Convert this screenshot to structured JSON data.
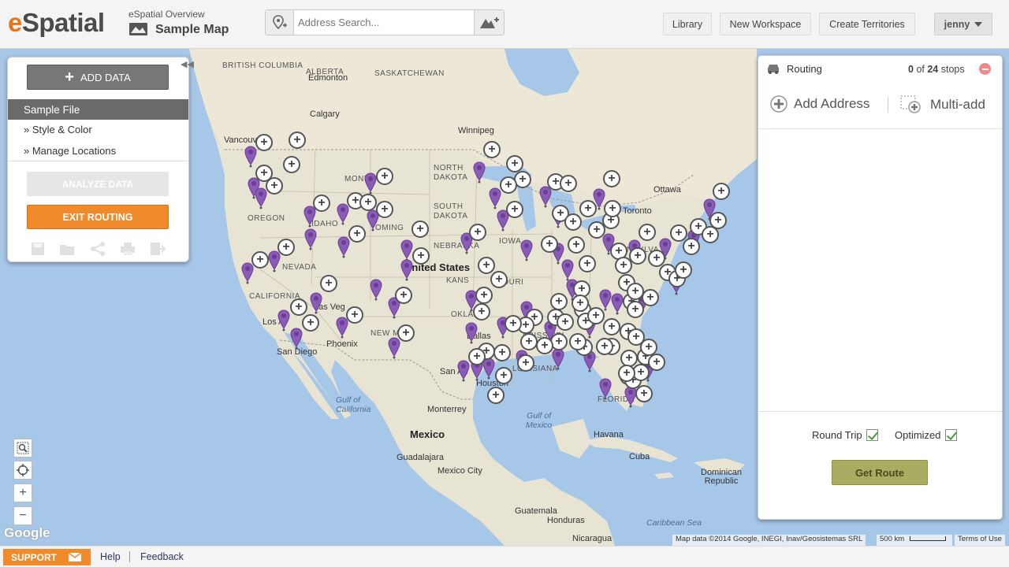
{
  "header": {
    "logo_e": "e",
    "logo_rest": "Spatial",
    "workspace_sub": "eSpatial Overview",
    "workspace_title": "Sample Map",
    "search_placeholder": "Address Search...",
    "buttons": {
      "library": "Library",
      "new_workspace": "New Workspace",
      "create_territories": "Create Territories"
    },
    "user": "jenny"
  },
  "left_panel": {
    "add_data": "ADD DATA",
    "sample_file": "Sample File",
    "style_color": "» Style & Color",
    "manage_locations": "» Manage Locations",
    "analyze": "ANALYZE DATA",
    "exit_routing": "EXIT ROUTING"
  },
  "routing_panel": {
    "title": "Routing",
    "stops_selected": "0",
    "stops_of": "of",
    "stops_total": "24",
    "stops_label": "stops",
    "add_address": "Add Address",
    "multi_add": "Multi-add",
    "round_trip": "Round Trip",
    "optimized": "Optimized",
    "get_route": "Get Route"
  },
  "map": {
    "labels": {
      "british_columbia": "BRITISH\nCOLUMBIA",
      "alberta": "ALBERTA",
      "saskatchewan": "SASKATCHEWAN",
      "edmonton": "Edmonton",
      "calgary": "Calgary",
      "vancouver": "Vancouver",
      "winnipeg": "Winnipeg",
      "ottawa": "Ottawa",
      "toronto": "Toronto",
      "montana": "MONTA",
      "north_dakota": "NORTH\nDAKOTA",
      "south_dakota": "SOUTH\nDAKOTA",
      "oregon": "OREGON",
      "idaho": "IDAHO",
      "wyoming": "OMING",
      "nebraska": "NEBRASKA",
      "iowa": "IOWA",
      "nevada": "NEVADA",
      "california": "CALIFORNIA",
      "united_states": "United States",
      "kansas": "KANS",
      "missouri": "SSOURI",
      "oklahoma": "OKLAHO",
      "new_mexico": "NEW M",
      "las_vegas": "Las Veg",
      "los_angeles": "Los A",
      "san_diego": "San Diego",
      "phoenix": "Phoenix",
      "dallas": "Dallas",
      "san_antonio": "San An",
      "houston": "Houston",
      "louisiana": "LOUISIANA",
      "mississippi": "SSISSIPPI",
      "pennsylvania": "ENNSYLVA",
      "florida": "FLORIDA",
      "gulf_california": "Gulf of\nCalifornia",
      "gulf_mexico": "Gulf of\nMexico",
      "mexico": "Mexico",
      "monterrey": "Monterrey",
      "guadalajara": "Guadalajara",
      "mexico_city": "Mexico City",
      "havana": "Havana",
      "cuba": "Cuba",
      "dominican_republic": "Dominican\nRepublic",
      "caribbean_sea": "Caribbean Sea",
      "guatemala": "Guatemala",
      "honduras": "Honduras",
      "nicaragua": "Nicaragua"
    },
    "google": "Google",
    "map_data": "Map data ©2014 Google, INEGI, Inav/Geosistemas SRL",
    "scale": "500 km",
    "terms": "Terms of Use"
  },
  "footer": {
    "support": "SUPPORT",
    "help": "Help",
    "feedback": "Feedback"
  },
  "colors": {
    "accent_orange": "#f08a2a",
    "pin_purple": "#8a5cb5",
    "water": "#a7c7e8",
    "land": "#e8e4d4",
    "get_route": "#a9ad62"
  }
}
